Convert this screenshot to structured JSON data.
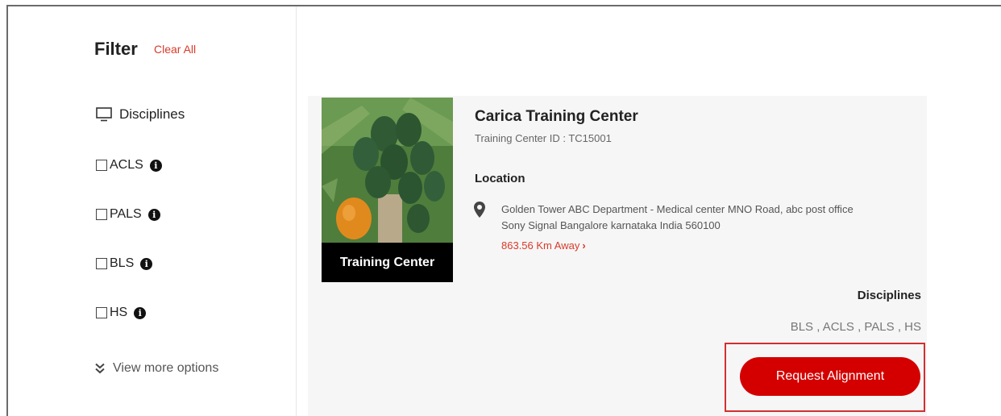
{
  "filter": {
    "title": "Filter",
    "clear_all": "Clear All",
    "section_label": "Disciplines",
    "options": [
      "ACLS",
      "PALS",
      "BLS",
      "HS"
    ],
    "view_more": "View more options"
  },
  "card": {
    "image_label": "Training Center",
    "name": "Carica Training Center",
    "center_id": "Training Center ID : TC15001",
    "location_label": "Location",
    "address_line1": "Golden Tower  ABC Department - Medical center  MNO Road, abc post office",
    "address_line2": "Sony Signal  Bangalore  karnataka  India  560100",
    "distance": "863.56 Km Away",
    "distance_arrow": "›",
    "disciplines_label": "Disciplines",
    "disciplines_values": "BLS , ACLS , PALS , HS",
    "request_button": "Request Alignment"
  },
  "colors": {
    "accent_red": "#d40000",
    "link_red": "#d93a2b",
    "highlight_border": "#d32f2f",
    "card_bg": "#f6f6f6"
  }
}
